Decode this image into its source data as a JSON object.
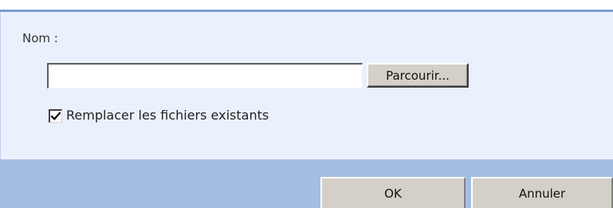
{
  "dialog": {
    "name_label": "Nom :",
    "file_input": {
      "value": "",
      "placeholder": ""
    },
    "browse_label": "Parcourir...",
    "overwrite_checkbox": {
      "label": "Remplacer les fichiers existants",
      "checked": true
    }
  },
  "footer": {
    "ok_label": "OK",
    "cancel_label": "Annuler"
  },
  "colors": {
    "top_rule": "#7f9fcf",
    "panel_background": "#eaf1fd",
    "footer_background": "#a5bde3",
    "button_face": "#d4d0c8"
  },
  "icons": {
    "checkbox_mark": "checkmark-icon"
  }
}
